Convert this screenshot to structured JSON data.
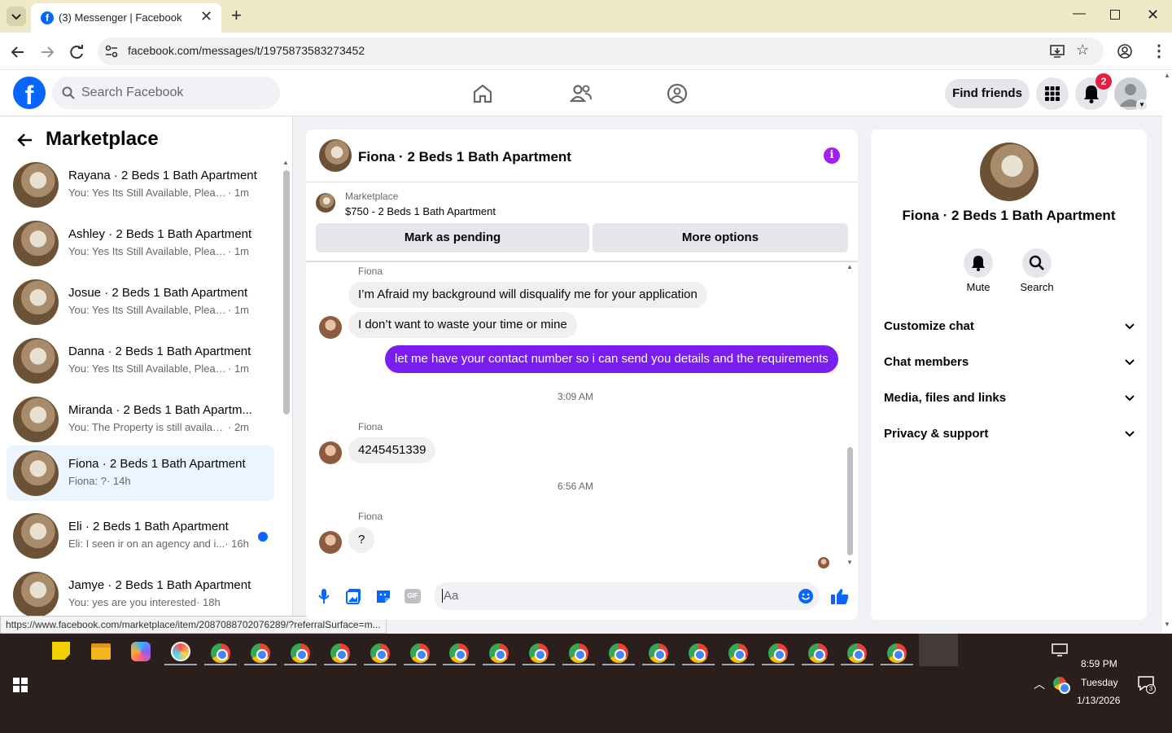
{
  "browser": {
    "tab_title": "(3) Messenger | Facebook",
    "url": "facebook.com/messages/t/1975873583273452"
  },
  "fb_header": {
    "search_placeholder": "Search Facebook",
    "find_friends": "Find friends",
    "notifications_count": "2"
  },
  "left_panel": {
    "title": "Marketplace",
    "conversations": [
      {
        "title": "Rayana · 2 Beds 1 Bath Apartment",
        "preview": "You: Yes Its Still Available, Please S...",
        "time": "· 1m",
        "active": false,
        "unread": false
      },
      {
        "title": "Ashley · 2 Beds 1 Bath Apartment",
        "preview": "You: Yes Its Still Available, Please S...",
        "time": "· 1m",
        "active": false,
        "unread": false
      },
      {
        "title": "Josue · 2 Beds 1 Bath Apartment",
        "preview": "You: Yes Its Still Available, Please S...",
        "time": "· 1m",
        "active": false,
        "unread": false
      },
      {
        "title": "Danna · 2 Beds 1 Bath Apartment",
        "preview": "You: Yes Its Still Available, Please S...",
        "time": "· 1m",
        "active": false,
        "unread": false
      },
      {
        "title": "Miranda · 2 Beds 1 Bath Apartm...",
        "preview": "You: The Property is still available. ...",
        "time": "· 2m",
        "active": false,
        "unread": false
      },
      {
        "title": "Fiona · 2 Beds 1 Bath Apartment",
        "preview": "Fiona: ?",
        "time": "· 14h",
        "active": true,
        "unread": false
      },
      {
        "title": "Eli · 2 Beds 1 Bath Apartment",
        "preview": "Eli: I seen ir on an agency and i...",
        "time": "· 16h",
        "active": false,
        "unread": true
      },
      {
        "title": "Jamye · 2 Beds 1 Bath Apartment",
        "preview": "You: yes are you interested",
        "time": "· 18h",
        "active": false,
        "unread": false
      }
    ]
  },
  "chat": {
    "title": "Fiona · 2 Beds 1 Bath Apartment",
    "listing_label": "Marketplace",
    "listing_text": "$750 - 2 Beds 1 Bath Apartment",
    "mark_pending": "Mark as pending",
    "more_options": "More options",
    "sender1": "Fiona",
    "msg1": "I’m Afraid my background will disqualify me for your application",
    "msg2": "I don’t want to waste your time or mine",
    "msg_out": "let me have your contact number so i can send you details and the requirements",
    "time1": "3:09 AM",
    "sender2": "Fiona",
    "msg3": "4245451339",
    "time2": "6:56 AM",
    "sender3": "Fiona",
    "msg4": "?",
    "composer_placeholder": "Aa"
  },
  "right_panel": {
    "title": "Fiona · 2 Beds 1 Bath Apartment",
    "mute": "Mute",
    "search": "Search",
    "sections": [
      "Customize chat",
      "Chat members",
      "Media, files and links",
      "Privacy & support"
    ]
  },
  "status_url": "https://www.facebook.com/marketplace/item/2087088702076289/?referralSurface=m...",
  "taskbar": {
    "time": "8:59 PM",
    "day": "Tuesday",
    "date": "1/13/2026",
    "notif_count": "3"
  },
  "colors": {
    "brand_blue": "#0866ff",
    "message_purple": "#7a1df0",
    "notification_red": "#e41e3f"
  }
}
